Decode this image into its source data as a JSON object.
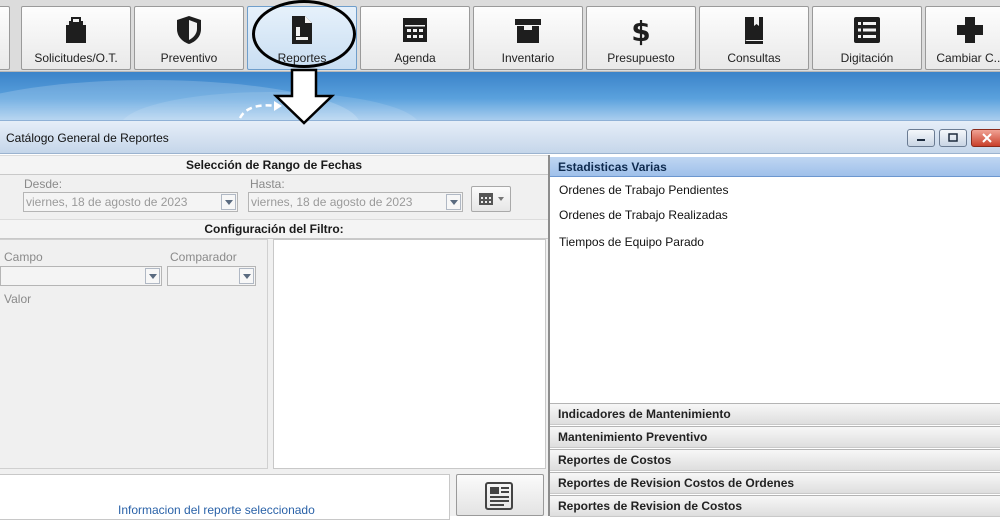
{
  "toolbar": {
    "buttons": [
      {
        "label": "Solicitudes/O.T.",
        "icon": "clipboard-icon"
      },
      {
        "label": "Preventivo",
        "icon": "shield-icon"
      },
      {
        "label": "Reportes",
        "icon": "report-document-icon",
        "active": true
      },
      {
        "label": "Agenda",
        "icon": "calendar-grid-icon"
      },
      {
        "label": "Inventario",
        "icon": "box-icon"
      },
      {
        "label": "Presupuesto",
        "icon": "dollar-icon"
      },
      {
        "label": "Consultas",
        "icon": "book-icon"
      },
      {
        "label": "Digitación",
        "icon": "list-icon"
      },
      {
        "label": "Cambiar C...",
        "icon": "plus-icon"
      }
    ]
  },
  "window": {
    "title": "Catálogo General de Reportes"
  },
  "date_range": {
    "header": "Selección de Rango de Fechas",
    "from_label": "Desde:",
    "from_value": "viernes, 18 de agosto de 2023",
    "to_label": "Hasta:",
    "to_value": "viernes, 18 de agosto de 2023"
  },
  "filter": {
    "header": "Configuración del Filtro:",
    "field_label": "Campo",
    "comparator_label": "Comparador",
    "value_label": "Valor"
  },
  "info": {
    "link_text": "Informacion del reporte seleccionado"
  },
  "report_groups": {
    "active_group": "Estadisticas Varias",
    "active_items": [
      "Ordenes de Trabajo Pendientes",
      "Ordenes de Trabajo Realizadas",
      "Tiempos de Equipo Parado"
    ],
    "collapsed_groups": [
      "Indicadores de Mantenimiento",
      "Mantenimiento Preventivo",
      "Reportes de Costos",
      "Reportes de Revision Costos de Ordenes",
      "Reportes de Revision de Costos"
    ]
  },
  "colors": {
    "banner": "#5aa1dd",
    "active_group_header": "#9fc0ea",
    "link": "#2a62a8"
  }
}
